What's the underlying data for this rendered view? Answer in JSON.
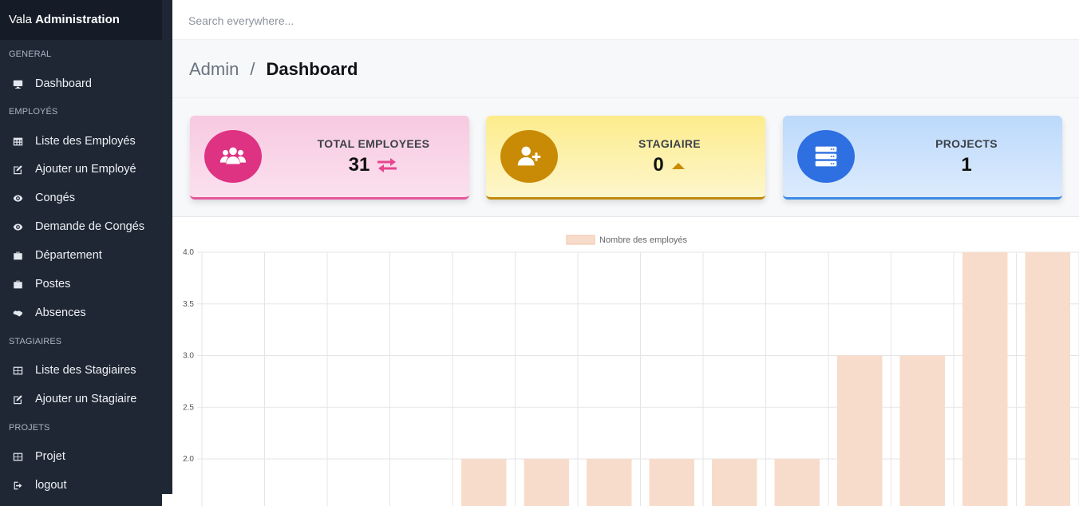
{
  "app": {
    "brand_prefix": "Vala",
    "brand_name": "Administration"
  },
  "sidebar": {
    "sections": [
      {
        "title": "GENERAL",
        "items": [
          {
            "label": "Dashboard",
            "icon": "monitor-icon"
          }
        ]
      },
      {
        "title": "EMPLOYÉS",
        "items": [
          {
            "label": "Liste des Employés",
            "icon": "table-icon"
          },
          {
            "label": "Ajouter un Employé",
            "icon": "edit-icon"
          },
          {
            "label": "Congés",
            "icon": "eye-icon"
          },
          {
            "label": "Demande de Congés",
            "icon": "eye-icon"
          },
          {
            "label": "Département",
            "icon": "briefcase-icon"
          },
          {
            "label": "Postes",
            "icon": "briefcase-icon"
          },
          {
            "label": "Absences",
            "icon": "handshake-icon"
          }
        ]
      },
      {
        "title": "STAGIAIRES",
        "items": [
          {
            "label": "Liste des Stagiaires",
            "icon": "table-icon"
          },
          {
            "label": "Ajouter un Stagiaire",
            "icon": "edit-icon"
          }
        ]
      },
      {
        "title": "PROJETS",
        "items": [
          {
            "label": "Projet",
            "icon": "table-icon"
          },
          {
            "label": "logout",
            "icon": "logout-icon"
          }
        ]
      }
    ]
  },
  "topbar": {
    "search_placeholder": "Search everywhere..."
  },
  "breadcrumb": {
    "parent": "Admin",
    "separator": "/",
    "current": "Dashboard"
  },
  "cards": [
    {
      "label": "TOTAL EMPLOYEES",
      "value": "31",
      "icon": "users-icon",
      "trend_icon": "exchange-icon",
      "accent": "#de3383"
    },
    {
      "label": "STAGIAIRE",
      "value": "0",
      "icon": "user-plus-icon",
      "trend_icon": "caret-up-icon",
      "accent": "#c98b05"
    },
    {
      "label": "PROJECTS",
      "value": "1",
      "icon": "server-icon",
      "trend_icon": "",
      "accent": "#2e6fe1"
    }
  ],
  "chart_data": {
    "type": "bar",
    "series": [
      {
        "name": "Nombre des employés",
        "color": "#f8dccb",
        "values": [
          null,
          null,
          null,
          null,
          2,
          2,
          2,
          2,
          2,
          2,
          3,
          3,
          4,
          4
        ]
      }
    ],
    "y_ticks": [
      "4.0",
      "3.5",
      "3.0",
      "2.5",
      "2.0"
    ],
    "ylim_visible": [
      1.75,
      4.0
    ],
    "grid": true,
    "legend_position": "top"
  }
}
